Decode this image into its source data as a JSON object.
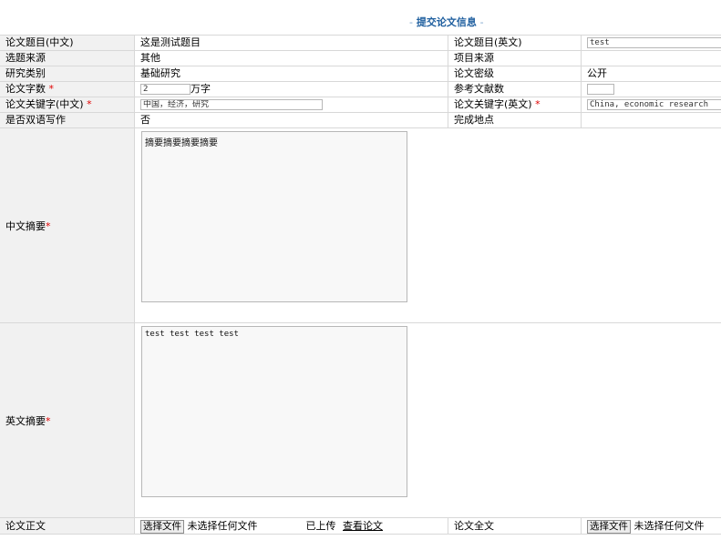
{
  "header": {
    "title": "提交论文信息",
    "dash_left": "-",
    "dash_right": "-"
  },
  "required_mark": "*",
  "rows": {
    "title": {
      "label_cn": "论文题目(中文)",
      "value_cn": "这是测试题目",
      "label_en": "论文题目(英文)",
      "value_en": "test"
    },
    "source": {
      "label": "选题来源",
      "value": "其他",
      "label2": "项目来源",
      "value2": ""
    },
    "category": {
      "label": "研究类别",
      "value": "基础研究",
      "label2": "论文密级",
      "value2": "公开"
    },
    "wordcount": {
      "label": "论文字数",
      "value": "2",
      "unit": "万字",
      "label2": "参考文献数",
      "value2": ""
    },
    "keywords": {
      "label_cn": "论文关键字(中文)",
      "value_cn": "中国，经济，研究",
      "label_en": "论文关键字(英文)",
      "value_en": "China, economic research"
    },
    "bilingual": {
      "label": "是否双语写作",
      "value": "否",
      "label2": "完成地点",
      "value2": ""
    },
    "abstract_cn": {
      "label": "中文摘要",
      "value": "摘要摘要摘要摘要"
    },
    "abstract_en": {
      "label": "英文摘要",
      "value": "test test test test"
    },
    "files": {
      "label": "论文正文",
      "button": "选择文件",
      "status": "未选择任何文件",
      "uploaded": "已上传",
      "view_link": "查看论文",
      "label2": "论文全文",
      "button2": "选择文件",
      "status2": "未选择任何文件"
    }
  }
}
